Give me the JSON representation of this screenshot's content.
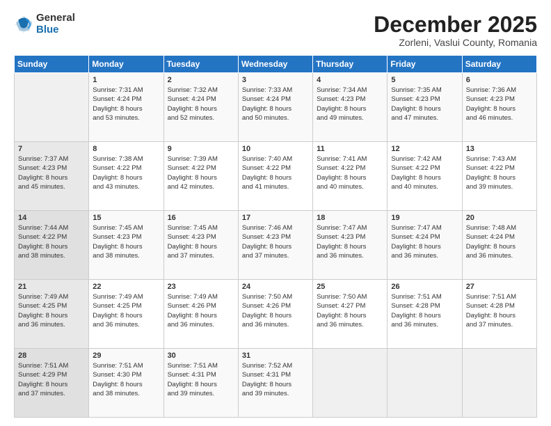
{
  "logo": {
    "general": "General",
    "blue": "Blue"
  },
  "title": "December 2025",
  "location": "Zorleni, Vaslui County, Romania",
  "days_header": [
    "Sunday",
    "Monday",
    "Tuesday",
    "Wednesday",
    "Thursday",
    "Friday",
    "Saturday"
  ],
  "weeks": [
    [
      {
        "num": "",
        "info": ""
      },
      {
        "num": "1",
        "info": "Sunrise: 7:31 AM\nSunset: 4:24 PM\nDaylight: 8 hours\nand 53 minutes."
      },
      {
        "num": "2",
        "info": "Sunrise: 7:32 AM\nSunset: 4:24 PM\nDaylight: 8 hours\nand 52 minutes."
      },
      {
        "num": "3",
        "info": "Sunrise: 7:33 AM\nSunset: 4:24 PM\nDaylight: 8 hours\nand 50 minutes."
      },
      {
        "num": "4",
        "info": "Sunrise: 7:34 AM\nSunset: 4:23 PM\nDaylight: 8 hours\nand 49 minutes."
      },
      {
        "num": "5",
        "info": "Sunrise: 7:35 AM\nSunset: 4:23 PM\nDaylight: 8 hours\nand 47 minutes."
      },
      {
        "num": "6",
        "info": "Sunrise: 7:36 AM\nSunset: 4:23 PM\nDaylight: 8 hours\nand 46 minutes."
      }
    ],
    [
      {
        "num": "7",
        "info": "Sunrise: 7:37 AM\nSunset: 4:23 PM\nDaylight: 8 hours\nand 45 minutes."
      },
      {
        "num": "8",
        "info": "Sunrise: 7:38 AM\nSunset: 4:22 PM\nDaylight: 8 hours\nand 43 minutes."
      },
      {
        "num": "9",
        "info": "Sunrise: 7:39 AM\nSunset: 4:22 PM\nDaylight: 8 hours\nand 42 minutes."
      },
      {
        "num": "10",
        "info": "Sunrise: 7:40 AM\nSunset: 4:22 PM\nDaylight: 8 hours\nand 41 minutes."
      },
      {
        "num": "11",
        "info": "Sunrise: 7:41 AM\nSunset: 4:22 PM\nDaylight: 8 hours\nand 40 minutes."
      },
      {
        "num": "12",
        "info": "Sunrise: 7:42 AM\nSunset: 4:22 PM\nDaylight: 8 hours\nand 40 minutes."
      },
      {
        "num": "13",
        "info": "Sunrise: 7:43 AM\nSunset: 4:22 PM\nDaylight: 8 hours\nand 39 minutes."
      }
    ],
    [
      {
        "num": "14",
        "info": "Sunrise: 7:44 AM\nSunset: 4:22 PM\nDaylight: 8 hours\nand 38 minutes."
      },
      {
        "num": "15",
        "info": "Sunrise: 7:45 AM\nSunset: 4:23 PM\nDaylight: 8 hours\nand 38 minutes."
      },
      {
        "num": "16",
        "info": "Sunrise: 7:45 AM\nSunset: 4:23 PM\nDaylight: 8 hours\nand 37 minutes."
      },
      {
        "num": "17",
        "info": "Sunrise: 7:46 AM\nSunset: 4:23 PM\nDaylight: 8 hours\nand 37 minutes."
      },
      {
        "num": "18",
        "info": "Sunrise: 7:47 AM\nSunset: 4:23 PM\nDaylight: 8 hours\nand 36 minutes."
      },
      {
        "num": "19",
        "info": "Sunrise: 7:47 AM\nSunset: 4:24 PM\nDaylight: 8 hours\nand 36 minutes."
      },
      {
        "num": "20",
        "info": "Sunrise: 7:48 AM\nSunset: 4:24 PM\nDaylight: 8 hours\nand 36 minutes."
      }
    ],
    [
      {
        "num": "21",
        "info": "Sunrise: 7:49 AM\nSunset: 4:25 PM\nDaylight: 8 hours\nand 36 minutes."
      },
      {
        "num": "22",
        "info": "Sunrise: 7:49 AM\nSunset: 4:25 PM\nDaylight: 8 hours\nand 36 minutes."
      },
      {
        "num": "23",
        "info": "Sunrise: 7:49 AM\nSunset: 4:26 PM\nDaylight: 8 hours\nand 36 minutes."
      },
      {
        "num": "24",
        "info": "Sunrise: 7:50 AM\nSunset: 4:26 PM\nDaylight: 8 hours\nand 36 minutes."
      },
      {
        "num": "25",
        "info": "Sunrise: 7:50 AM\nSunset: 4:27 PM\nDaylight: 8 hours\nand 36 minutes."
      },
      {
        "num": "26",
        "info": "Sunrise: 7:51 AM\nSunset: 4:28 PM\nDaylight: 8 hours\nand 36 minutes."
      },
      {
        "num": "27",
        "info": "Sunrise: 7:51 AM\nSunset: 4:28 PM\nDaylight: 8 hours\nand 37 minutes."
      }
    ],
    [
      {
        "num": "28",
        "info": "Sunrise: 7:51 AM\nSunset: 4:29 PM\nDaylight: 8 hours\nand 37 minutes."
      },
      {
        "num": "29",
        "info": "Sunrise: 7:51 AM\nSunset: 4:30 PM\nDaylight: 8 hours\nand 38 minutes."
      },
      {
        "num": "30",
        "info": "Sunrise: 7:51 AM\nSunset: 4:31 PM\nDaylight: 8 hours\nand 39 minutes."
      },
      {
        "num": "31",
        "info": "Sunrise: 7:52 AM\nSunset: 4:31 PM\nDaylight: 8 hours\nand 39 minutes."
      },
      {
        "num": "",
        "info": ""
      },
      {
        "num": "",
        "info": ""
      },
      {
        "num": "",
        "info": ""
      }
    ]
  ]
}
